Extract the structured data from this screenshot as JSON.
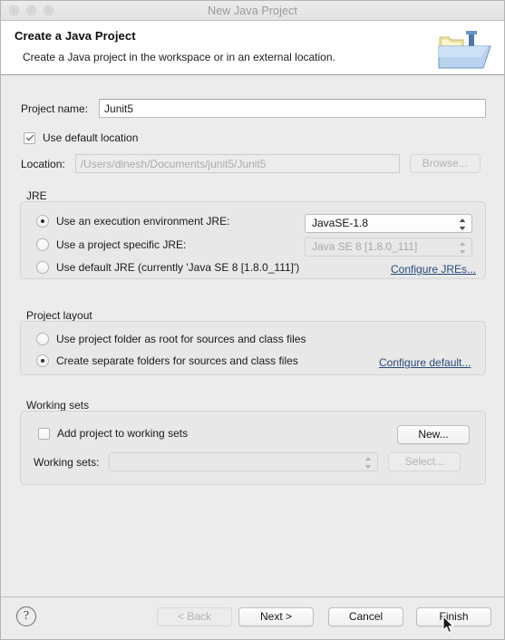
{
  "window": {
    "title": "New Java Project",
    "traffic_lights": [
      "close",
      "minimize",
      "maximize"
    ]
  },
  "header": {
    "title": "Create a Java Project",
    "description": "Create a Java project in the workspace or in an external location.",
    "icon": "java-project-folder-icon"
  },
  "project": {
    "name_label": "Project name:",
    "name_value": "Junit5",
    "name_placeholder": "",
    "use_default_location_label": "Use default location",
    "use_default_location_checked": true,
    "location_label": "Location:",
    "location_value": "/Users/dinesh/Documents/junit5/Junit5",
    "location_enabled": false,
    "browse_label": "Browse...",
    "browse_enabled": false
  },
  "jre": {
    "group_title": "JRE",
    "options": [
      {
        "label": "Use an execution environment JRE:",
        "selected": true,
        "combo_value": "JavaSE-1.8",
        "combo_enabled": true
      },
      {
        "label": "Use a project specific JRE:",
        "selected": false,
        "combo_value": "Java SE 8 [1.8.0_111]",
        "combo_enabled": false
      },
      {
        "label": "Use default JRE (currently 'Java SE 8 [1.8.0_111]')",
        "selected": false
      }
    ],
    "configure_link": "Configure JREs..."
  },
  "project_layout": {
    "group_title": "Project layout",
    "options": [
      {
        "label": "Use project folder as root for sources and class files",
        "selected": false
      },
      {
        "label": "Create separate folders for sources and class files",
        "selected": true
      }
    ],
    "configure_link": "Configure default..."
  },
  "working_sets": {
    "group_title": "Working sets",
    "add_label": "Add project to working sets",
    "add_checked": false,
    "new_label": "New...",
    "new_enabled": true,
    "sets_label": "Working sets:",
    "sets_value": "",
    "sets_enabled": false,
    "select_label": "Select...",
    "select_enabled": false
  },
  "footer": {
    "help_glyph": "?",
    "buttons": [
      {
        "label": "< Back",
        "enabled": false
      },
      {
        "label": "Next >",
        "enabled": true
      },
      {
        "label": "Cancel",
        "enabled": true
      },
      {
        "label": "Finish",
        "enabled": true,
        "default": true
      }
    ]
  },
  "colors": {
    "link": "#29487d",
    "dialog_bg": "#ececec",
    "group_bg": "#e8e8e8",
    "header_bg": "#ffffff"
  }
}
